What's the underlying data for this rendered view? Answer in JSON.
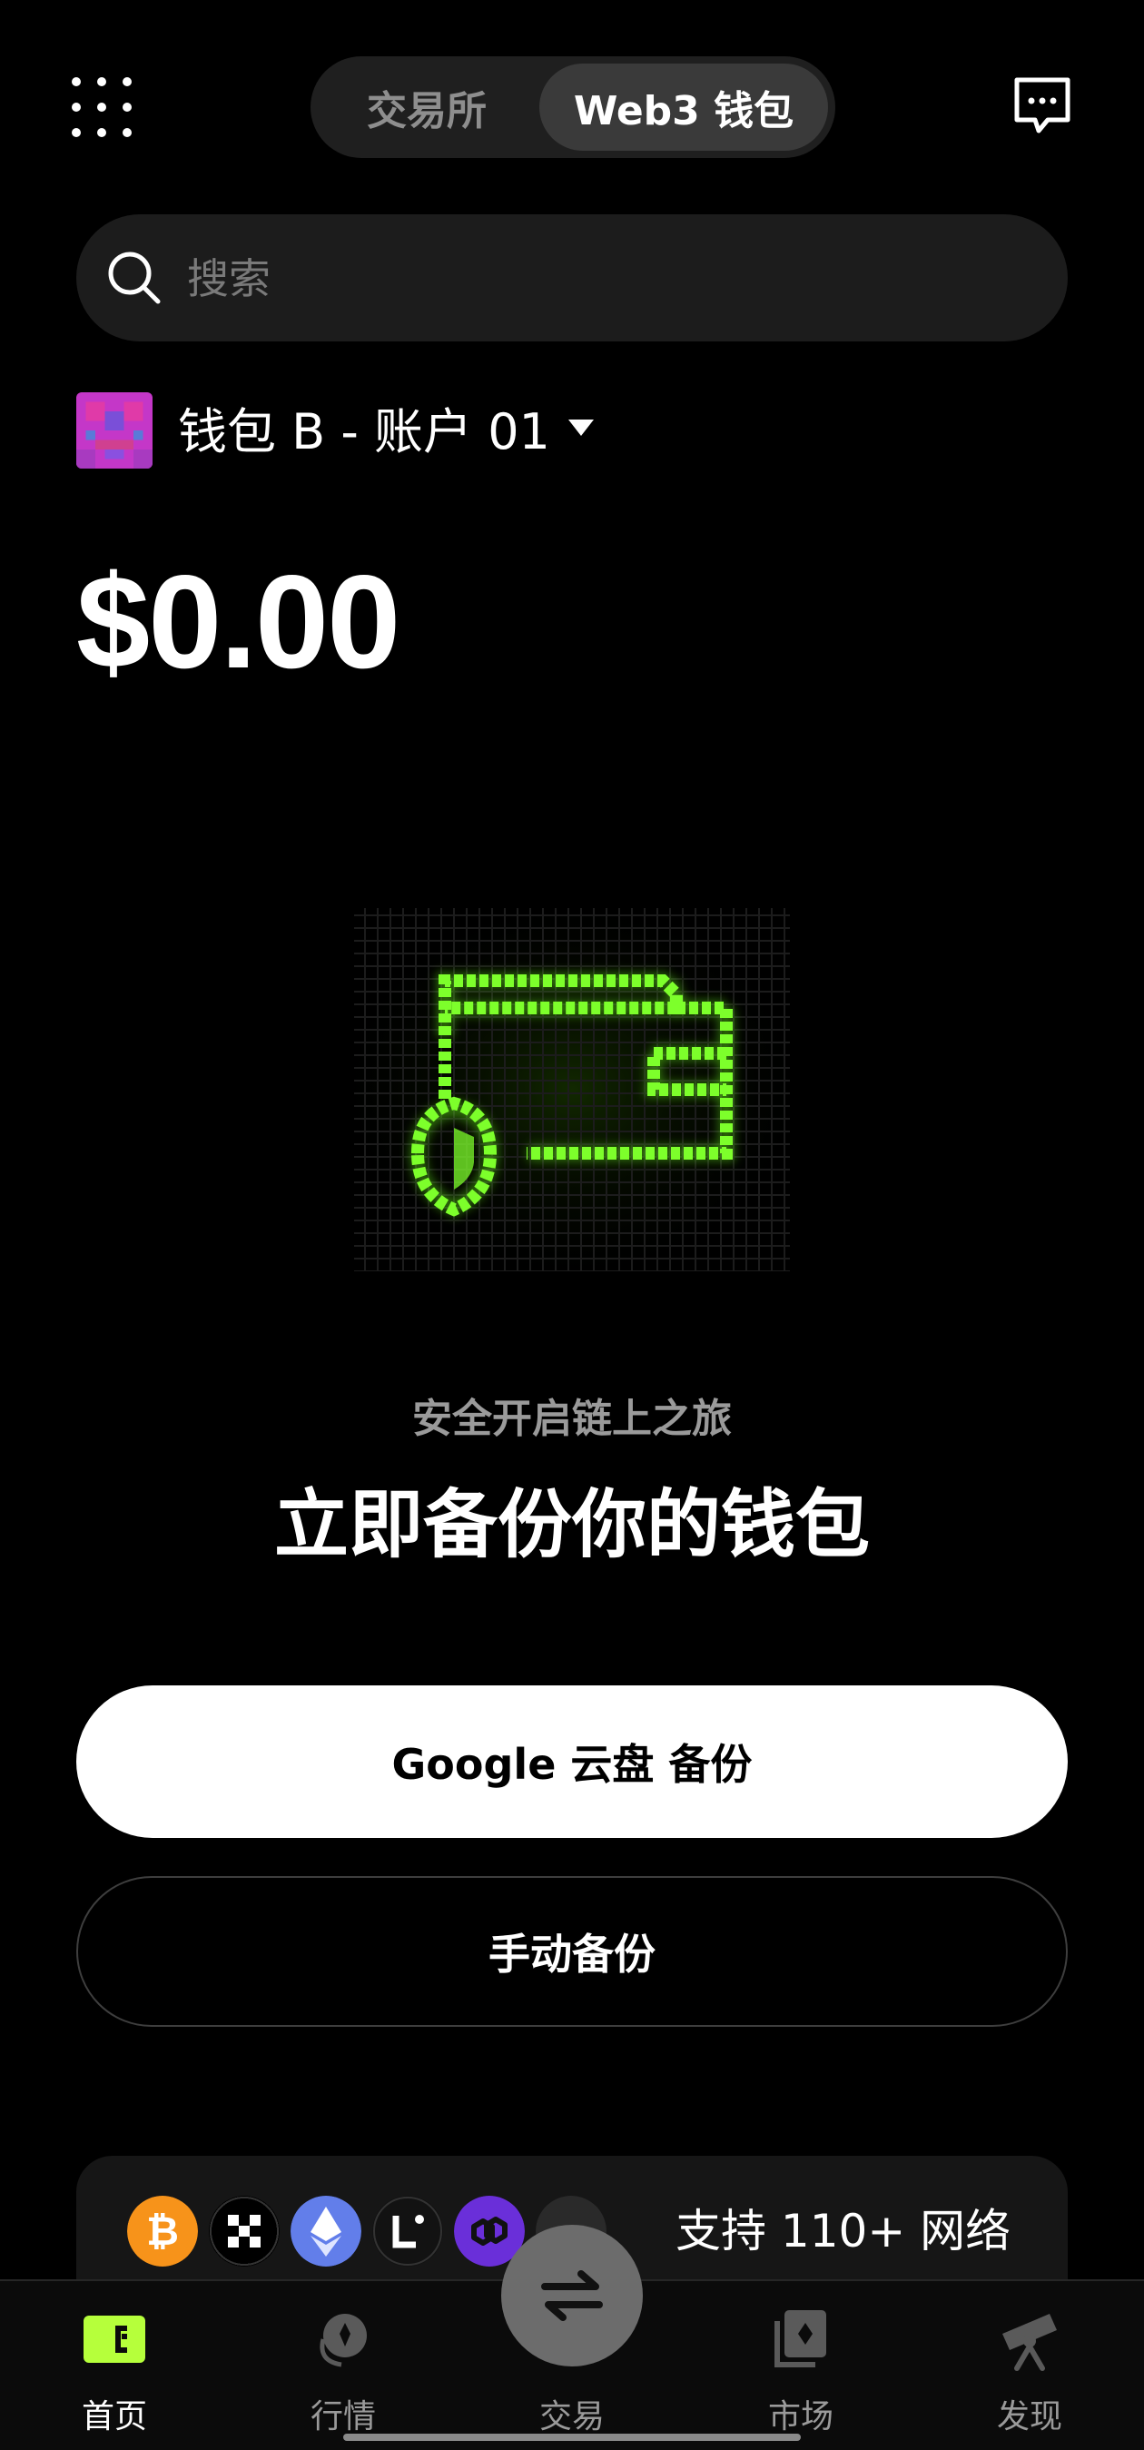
{
  "header": {
    "tab_exchange": "交易所",
    "tab_web3": "Web3 钱包",
    "active_tab": "Web3 钱包"
  },
  "search": {
    "placeholder": "搜索"
  },
  "account": {
    "name": "钱包 B - 账户 01"
  },
  "balance": {
    "value": "$0.00"
  },
  "promo": {
    "subtitle": "安全开启链上之旅",
    "headline": "立即备份你的钱包"
  },
  "buttons": {
    "google_backup": "Google 云盘 备份",
    "manual_backup": "手动备份"
  },
  "networks": {
    "label": "支持 110+ 网络",
    "icons": [
      "bitcoin-icon",
      "okx-icon",
      "ethereum-icon",
      "linea-icon",
      "polygon-icon",
      "more-networks-icon"
    ]
  },
  "nav": {
    "items": [
      {
        "label": "首页",
        "icon": "wallet-icon",
        "active": true
      },
      {
        "label": "行情",
        "icon": "market-icon",
        "active": false
      },
      {
        "label": "交易",
        "icon": "swap-icon",
        "active": false
      },
      {
        "label": "市场",
        "icon": "nft-market-icon",
        "active": false
      },
      {
        "label": "发现",
        "icon": "telescope-icon",
        "active": false
      }
    ]
  },
  "colors": {
    "background": "#000000",
    "accent_green": "#b6ff3b",
    "illustration_green": "#6dff1f",
    "button_primary_bg": "#ffffff",
    "button_primary_text": "#000000",
    "muted_text": "#9a9a9a"
  }
}
